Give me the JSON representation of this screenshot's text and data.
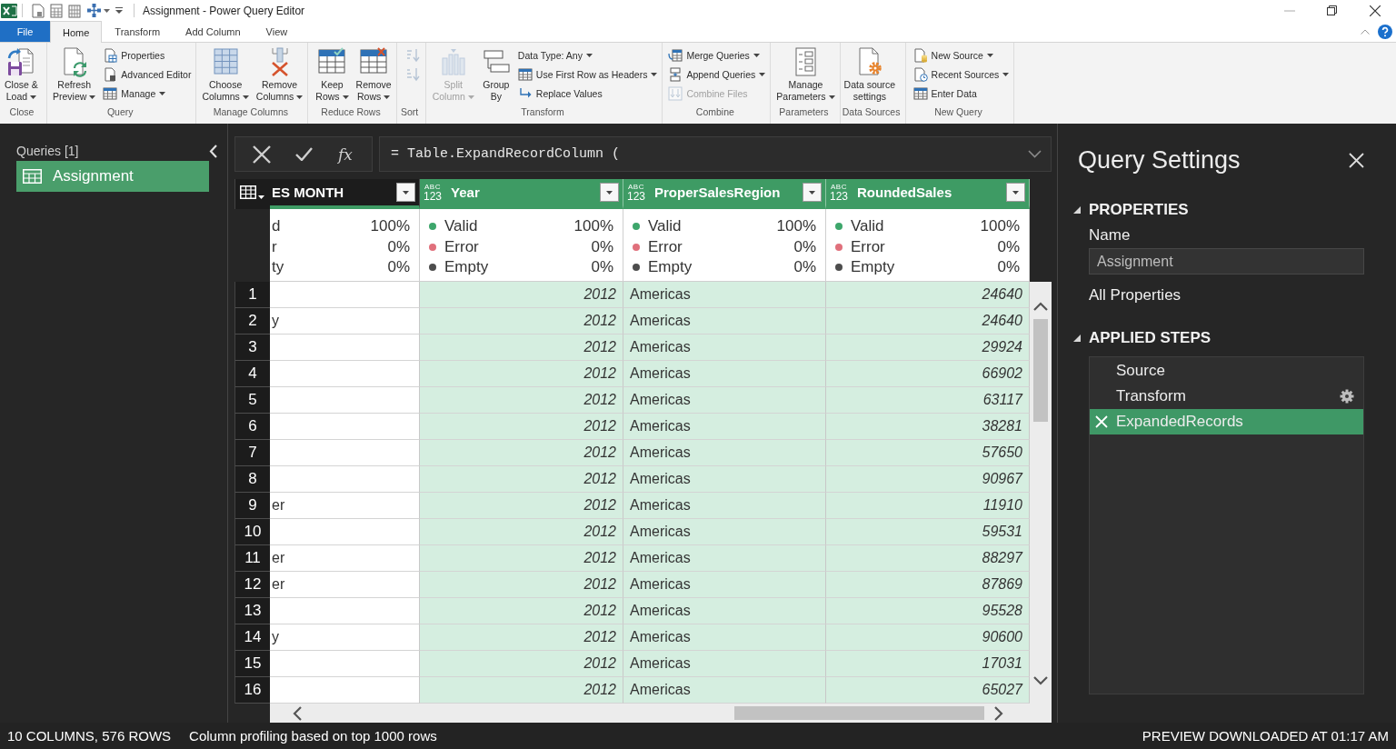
{
  "window": {
    "title": "Assignment - Power Query Editor"
  },
  "ribbon_tabs": [
    {
      "label": "File",
      "kind": "file",
      "selected": false
    },
    {
      "label": "Home",
      "kind": "tab",
      "selected": true
    },
    {
      "label": "Transform",
      "kind": "tab",
      "selected": false
    },
    {
      "label": "Add Column",
      "kind": "tab",
      "selected": false
    },
    {
      "label": "View",
      "kind": "tab",
      "selected": false
    }
  ],
  "ribbon_groups": [
    {
      "label": "Close",
      "items": [
        {
          "kind": "large",
          "lines": [
            "Close &",
            "Load"
          ],
          "dropdown": true,
          "disabled": false
        }
      ]
    },
    {
      "label": "Query",
      "items": [
        {
          "kind": "large",
          "lines": [
            "Refresh",
            "Preview"
          ],
          "dropdown": true,
          "disabled": false
        },
        {
          "kind": "stack",
          "entries": [
            {
              "label": "Properties",
              "dropdown": false,
              "disabled": false
            },
            {
              "label": "Advanced Editor",
              "dropdown": false,
              "disabled": false
            },
            {
              "label": "Manage",
              "dropdown": true,
              "disabled": false
            }
          ]
        }
      ]
    },
    {
      "label": "Manage Columns",
      "items": [
        {
          "kind": "large",
          "lines": [
            "Choose",
            "Columns"
          ],
          "dropdown": true,
          "disabled": false
        },
        {
          "kind": "large",
          "lines": [
            "Remove",
            "Columns"
          ],
          "dropdown": true,
          "disabled": false
        }
      ]
    },
    {
      "label": "Reduce Rows",
      "items": [
        {
          "kind": "large",
          "lines": [
            "Keep",
            "Rows"
          ],
          "dropdown": true,
          "disabled": false
        },
        {
          "kind": "large",
          "lines": [
            "Remove",
            "Rows"
          ],
          "dropdown": true,
          "disabled": false
        }
      ]
    },
    {
      "label": "Sort",
      "items": [
        {
          "kind": "stack",
          "entries": [
            {
              "disabled": true
            },
            {
              "disabled": true
            }
          ]
        }
      ]
    },
    {
      "label": "Transform",
      "items": [
        {
          "kind": "large",
          "lines": [
            "Split",
            "Column"
          ],
          "dropdown": true,
          "disabled": true
        },
        {
          "kind": "large",
          "lines": [
            "Group",
            "By"
          ],
          "dropdown": false,
          "disabled": false
        },
        {
          "kind": "stack",
          "entries": [
            {
              "label": "Data Type: Any",
              "dropdown": true,
              "disabled": false
            },
            {
              "label": "Use First Row as Headers",
              "dropdown": true,
              "disabled": false
            },
            {
              "label": "Replace Values",
              "dropdown": false,
              "disabled": false
            }
          ]
        }
      ]
    },
    {
      "label": "Combine",
      "items": [
        {
          "kind": "stack",
          "entries": [
            {
              "label": "Merge Queries",
              "dropdown": true,
              "disabled": false
            },
            {
              "label": "Append Queries",
              "dropdown": true,
              "disabled": false
            },
            {
              "label": "Combine Files",
              "dropdown": false,
              "disabled": true
            }
          ]
        }
      ]
    },
    {
      "label": "Parameters",
      "items": [
        {
          "kind": "large",
          "lines": [
            "Manage",
            "Parameters"
          ],
          "dropdown": true,
          "disabled": false
        }
      ]
    },
    {
      "label": "Data Sources",
      "items": [
        {
          "kind": "large",
          "lines": [
            "Data source",
            "settings"
          ],
          "dropdown": false,
          "disabled": false
        }
      ]
    },
    {
      "label": "New Query",
      "items": [
        {
          "kind": "stack",
          "entries": [
            {
              "label": "New Source",
              "dropdown": true,
              "disabled": false
            },
            {
              "label": "Recent Sources",
              "dropdown": true,
              "disabled": false
            },
            {
              "label": "Enter Data",
              "dropdown": false,
              "disabled": false
            }
          ]
        }
      ]
    }
  ],
  "queries_pane": {
    "title": "Queries [1]",
    "items": [
      {
        "label": "Assignment",
        "selected": true
      }
    ]
  },
  "formula_bar": {
    "function_button": "fx",
    "formula": "= Table.ExpandRecordColumn ("
  },
  "table": {
    "cut_column": {
      "header": "ES MONTH",
      "selected": false,
      "profile": [
        {
          "label": "d",
          "percent": "100%"
        },
        {
          "label": "r",
          "percent": "0%"
        },
        {
          "label": "ty",
          "percent": "0%"
        }
      ]
    },
    "columns": [
      {
        "header": "Year",
        "type_badge": [
          "ABC",
          "123"
        ],
        "kind": "number",
        "selected": true,
        "profile": [
          {
            "label": "Valid",
            "percent": "100%",
            "color": "#3da66b"
          },
          {
            "label": "Error",
            "percent": "0%",
            "color": "#e0707c"
          },
          {
            "label": "Empty",
            "percent": "0%",
            "color": "#4d4d4d"
          }
        ]
      },
      {
        "header": "ProperSalesRegion",
        "type_badge": [
          "ABC",
          "123"
        ],
        "kind": "text",
        "selected": true,
        "profile": [
          {
            "label": "Valid",
            "percent": "100%",
            "color": "#3da66b"
          },
          {
            "label": "Error",
            "percent": "0%",
            "color": "#e0707c"
          },
          {
            "label": "Empty",
            "percent": "0%",
            "color": "#4d4d4d"
          }
        ]
      },
      {
        "header": "RoundedSales",
        "type_badge": [
          "ABC",
          "123"
        ],
        "kind": "number",
        "selected": true,
        "profile": [
          {
            "label": "Valid",
            "percent": "100%",
            "color": "#3da66b"
          },
          {
            "label": "Error",
            "percent": "0%",
            "color": "#e0707c"
          },
          {
            "label": "Empty",
            "percent": "0%",
            "color": "#4d4d4d"
          }
        ]
      }
    ],
    "rows": [
      {
        "number": "1",
        "cells": [
          "2012",
          "Americas",
          "24640"
        ]
      },
      {
        "number": "2",
        "cut_cell": "y",
        "cells": [
          "2012",
          "Americas",
          "24640"
        ]
      },
      {
        "number": "3",
        "cells": [
          "2012",
          "Americas",
          "29924"
        ]
      },
      {
        "number": "4",
        "cells": [
          "2012",
          "Americas",
          "66902"
        ]
      },
      {
        "number": "5",
        "cells": [
          "2012",
          "Americas",
          "63117"
        ]
      },
      {
        "number": "6",
        "cells": [
          "2012",
          "Americas",
          "38281"
        ]
      },
      {
        "number": "7",
        "cells": [
          "2012",
          "Americas",
          "57650"
        ]
      },
      {
        "number": "8",
        "cells": [
          "2012",
          "Americas",
          "90967"
        ]
      },
      {
        "number": "9",
        "cut_cell": "er",
        "cells": [
          "2012",
          "Americas",
          "11910"
        ]
      },
      {
        "number": "10",
        "cells": [
          "2012",
          "Americas",
          "59531"
        ]
      },
      {
        "number": "11",
        "cut_cell": "er",
        "cells": [
          "2012",
          "Americas",
          "88297"
        ]
      },
      {
        "number": "12",
        "cut_cell": "er",
        "cells": [
          "2012",
          "Americas",
          "87869"
        ]
      },
      {
        "number": "13",
        "cells": [
          "2012",
          "Americas",
          "95528"
        ]
      },
      {
        "number": "14",
        "cut_cell": "y",
        "cells": [
          "2012",
          "Americas",
          "90600"
        ]
      },
      {
        "number": "15",
        "cells": [
          "2012",
          "Americas",
          "17031"
        ]
      },
      {
        "number": "16",
        "cells": [
          "2012",
          "Americas",
          "65027"
        ]
      }
    ]
  },
  "query_settings": {
    "title": "Query Settings",
    "properties": {
      "heading": "PROPERTIES",
      "expanded": true,
      "name_label": "Name",
      "name_value": "Assignment",
      "link": "All Properties"
    },
    "applied_steps": {
      "heading": "APPLIED STEPS",
      "expanded": true,
      "steps": [
        {
          "label": "Source",
          "selected": false,
          "settings": false
        },
        {
          "label": "Transform",
          "selected": false,
          "settings": true
        },
        {
          "label": "ExpandedRecords",
          "selected": true,
          "settings": false
        }
      ]
    }
  },
  "status_bar": {
    "left": [
      "10 COLUMNS, 576 ROWS",
      "Column profiling based on top 1000 rows"
    ],
    "right": "PREVIEW DOWNLOADED AT 01:17 AM"
  }
}
